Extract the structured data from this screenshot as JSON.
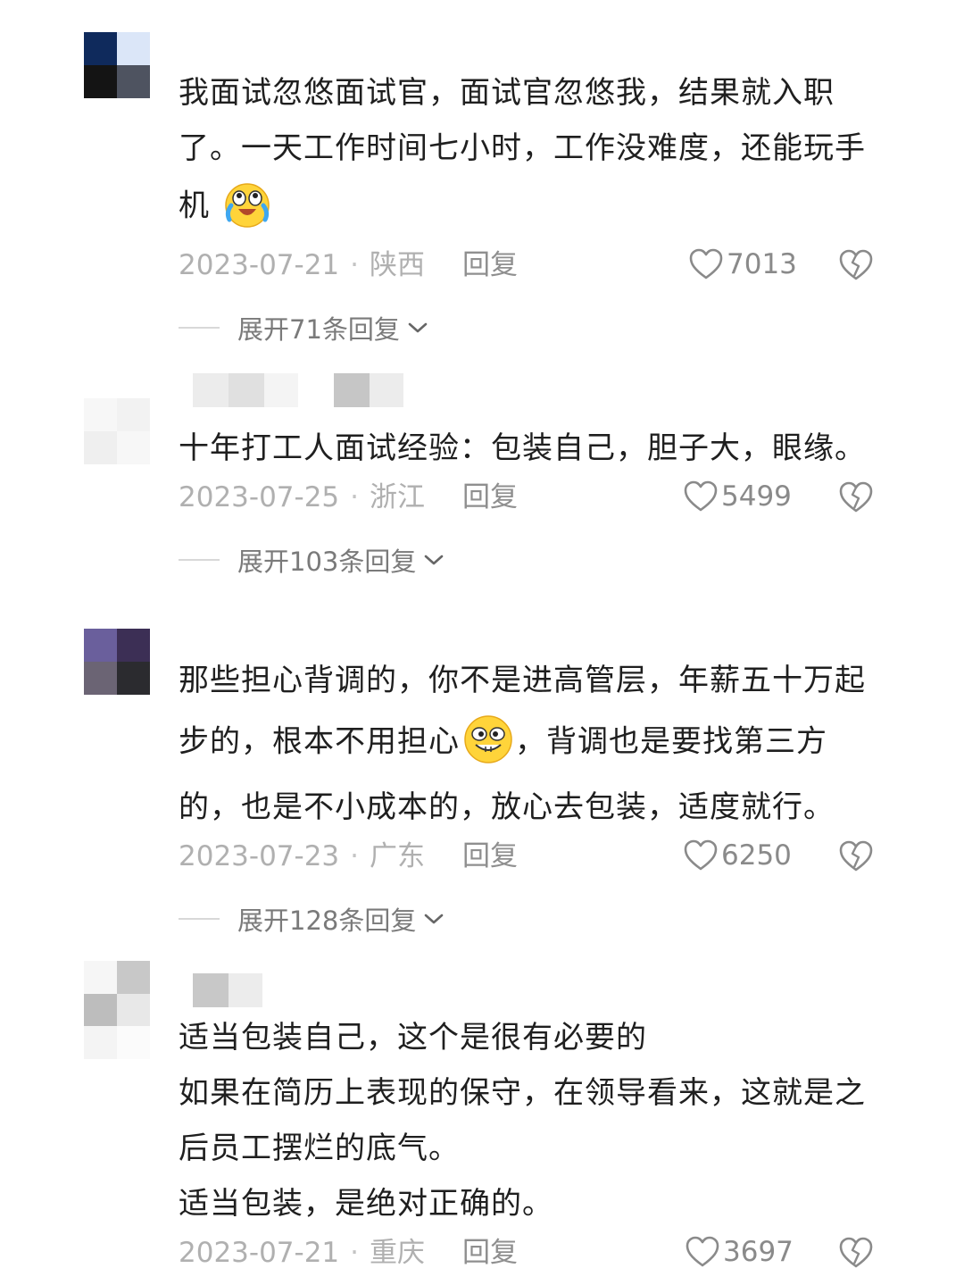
{
  "comments": [
    {
      "lines": [
        "我面试忽悠面试官，面试官忽悠我，结果就入职",
        "了。一天工作时间七小时，工作没难度，还能玩手",
        "机"
      ],
      "date": "2023-07-21",
      "location": "陕西",
      "reply_label": "回复",
      "likes": "7013",
      "expand_label": "展开71条回复",
      "emoji": "laugh-cry-icon"
    },
    {
      "lines": [
        "十年打工人面试经验：包装自己，胆子大，眼缘。"
      ],
      "date": "2023-07-25",
      "location": "浙江",
      "reply_label": "回复",
      "likes": "5499",
      "expand_label": "展开103条回复"
    },
    {
      "lines": [
        "那些担心背调的，你不是进高管层，年薪五十万起",
        "步的，根本不用担心",
        "，背调也是要找第三方",
        "的，也是不小成本的，放心去包装，适度就行。"
      ],
      "date": "2023-07-23",
      "location": "广东",
      "reply_label": "回复",
      "likes": "6250",
      "expand_label": "展开128条回复",
      "emoji": "grin-icon"
    },
    {
      "lines": [
        "适当包装自己，这个是很有必要的",
        "如果在简历上表现的保守，在领导看来，这就是之",
        "后员工摆烂的底气。",
        "适当包装，是绝对正确的。"
      ],
      "date": "2023-07-21",
      "location": "重庆",
      "reply_label": "回复",
      "likes": "3697"
    }
  ],
  "meta_separator": "·",
  "colors": {
    "text": "#1f1f1f",
    "meta": "#b0b0b0",
    "reply": "#8f8f8f"
  }
}
